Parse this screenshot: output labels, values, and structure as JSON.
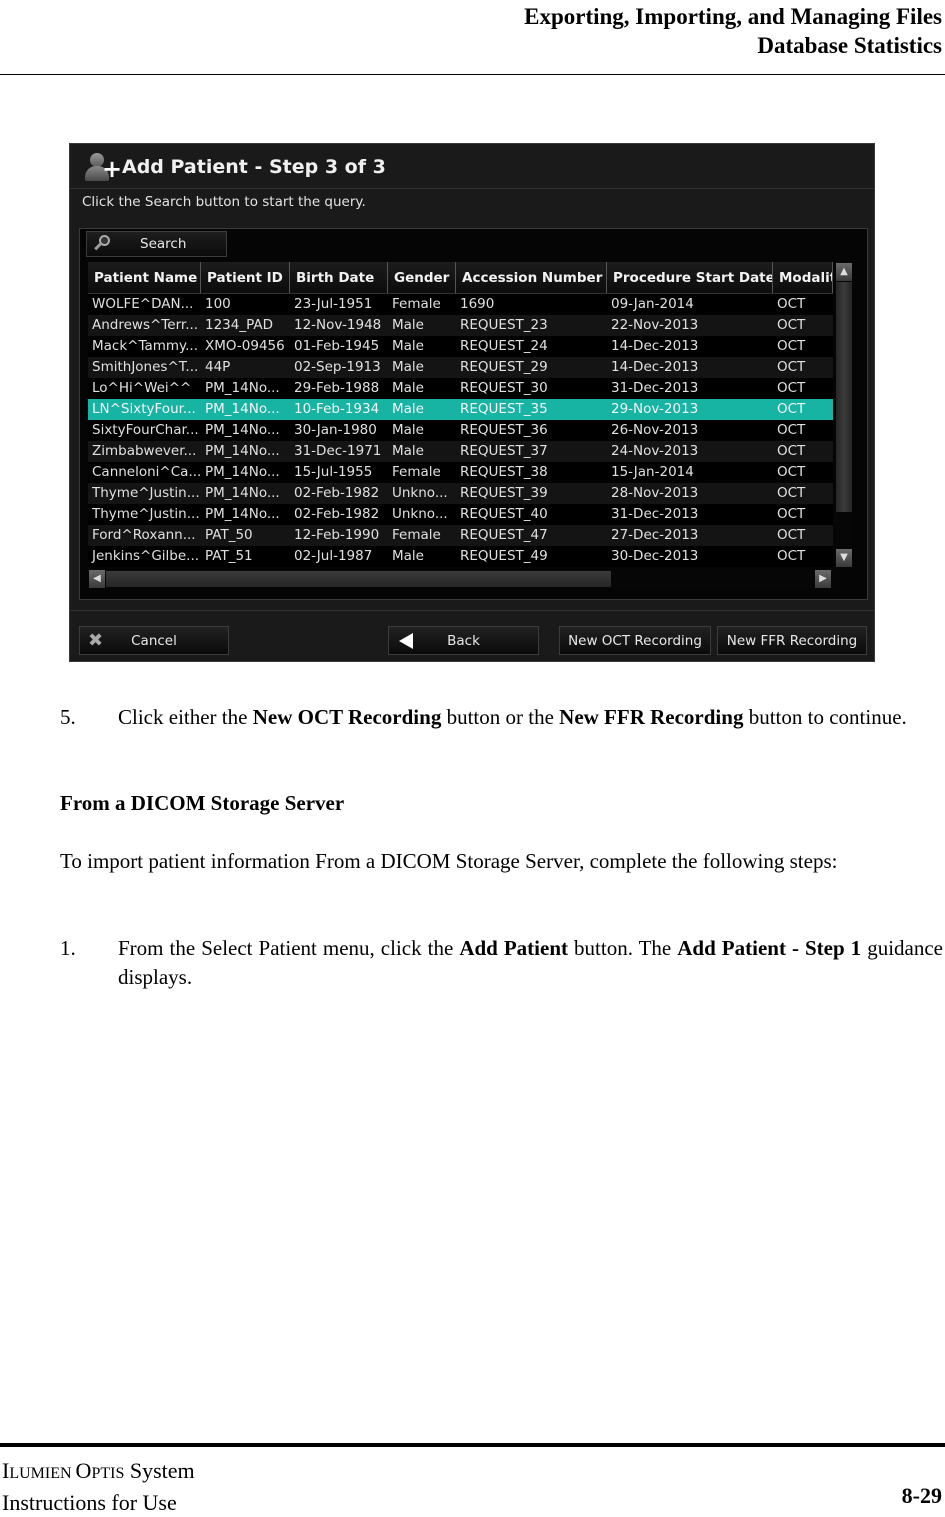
{
  "header": {
    "line1": "Exporting, Importing, and Managing Files",
    "line2": "Database Statistics"
  },
  "dialog": {
    "title": "Add Patient - Step 3 of 3",
    "title_icon": "add-user-icon",
    "instruction": "Click the Search button to start the query.",
    "search_label": "Search",
    "columns": [
      "Patient Name",
      "Patient ID",
      "Birth Date",
      "Gender",
      "Accession Number",
      "Procedure Start Date",
      "Modalit"
    ],
    "rows": [
      [
        "WOLFE^DAN...",
        "100",
        "23-Jul-1951",
        "Female",
        "1690",
        "09-Jan-2014",
        "OCT"
      ],
      [
        "Andrews^Terr...",
        "1234_PAD",
        "12-Nov-1948",
        "Male",
        "REQUEST_23",
        "22-Nov-2013",
        "OCT"
      ],
      [
        "Mack^Tammy...",
        "XMO-09456",
        "01-Feb-1945",
        "Male",
        "REQUEST_24",
        "14-Dec-2013",
        "OCT"
      ],
      [
        "SmithJones^T...",
        "44P",
        "02-Sep-1913",
        "Male",
        "REQUEST_29",
        "14-Dec-2013",
        "OCT"
      ],
      [
        "Lo^Hi^Wei^^",
        "PM_14No...",
        "29-Feb-1988",
        "Male",
        "REQUEST_30",
        "31-Dec-2013",
        "OCT"
      ],
      [
        "LN^SixtyFour...",
        "PM_14No...",
        "10-Feb-1934",
        "Male",
        "REQUEST_35",
        "29-Nov-2013",
        "OCT"
      ],
      [
        "SixtyFourChar...",
        "PM_14No...",
        "30-Jan-1980",
        "Male",
        "REQUEST_36",
        "26-Nov-2013",
        "OCT"
      ],
      [
        "Zimbabwever...",
        "PM_14No...",
        "31-Dec-1971",
        "Male",
        "REQUEST_37",
        "24-Nov-2013",
        "OCT"
      ],
      [
        "Canneloni^Ca...",
        "PM_14No...",
        "15-Jul-1955",
        "Female",
        "REQUEST_38",
        "15-Jan-2014",
        "OCT"
      ],
      [
        "Thyme^Justin...",
        "PM_14No...",
        "02-Feb-1982",
        "Unkno...",
        "REQUEST_39",
        "28-Nov-2013",
        "OCT"
      ],
      [
        "Thyme^Justin...",
        "PM_14No...",
        "02-Feb-1982",
        "Unkno...",
        "REQUEST_40",
        "31-Dec-2013",
        "OCT"
      ],
      [
        "Ford^Roxann...",
        "PAT_50",
        "12-Feb-1990",
        "Female",
        "REQUEST_47",
        "27-Dec-2013",
        "OCT"
      ],
      [
        "Jenkins^Gilbe...",
        "PAT_51",
        "02-Jul-1987",
        "Male",
        "REQUEST_49",
        "30-Dec-2013",
        "OCT"
      ]
    ],
    "selected_row": 5,
    "selection_color": "#17b3a3",
    "buttons": {
      "cancel": "Cancel",
      "back": "Back",
      "new_oct": "New OCT Recording",
      "new_ffr": "New FFR Recording"
    },
    "scroll_icons": {
      "up": "▲",
      "down": "▼",
      "left": "◀",
      "right": "▶",
      "cancel": "✖"
    }
  },
  "body": {
    "step5_num": "5.",
    "step5_a": "Click either the ",
    "step5_b1": "New OCT Recording",
    "step5_c": " button or the ",
    "step5_b2": "New FFR Recording",
    "step5_d": " button to continue.",
    "section_heading": "From a DICOM Storage Server",
    "intro": "To import patient information From a DICOM Storage Server, complete the following steps:",
    "step1_num": "1.",
    "step1_a": "From the Select Patient menu, click the ",
    "step1_b1": "Add Patient",
    "step1_c": " button. The ",
    "step1_b2": "Add Patient - Step 1",
    "step1_d": " guidance displays."
  },
  "footer": {
    "product_first_I": "I",
    "product_rest1": "LUMIEN ",
    "product_first_O": "O",
    "product_rest2": "PTIS",
    "product_suffix": " System",
    "doc_type": "Instructions for Use",
    "page_number": "8-29"
  }
}
